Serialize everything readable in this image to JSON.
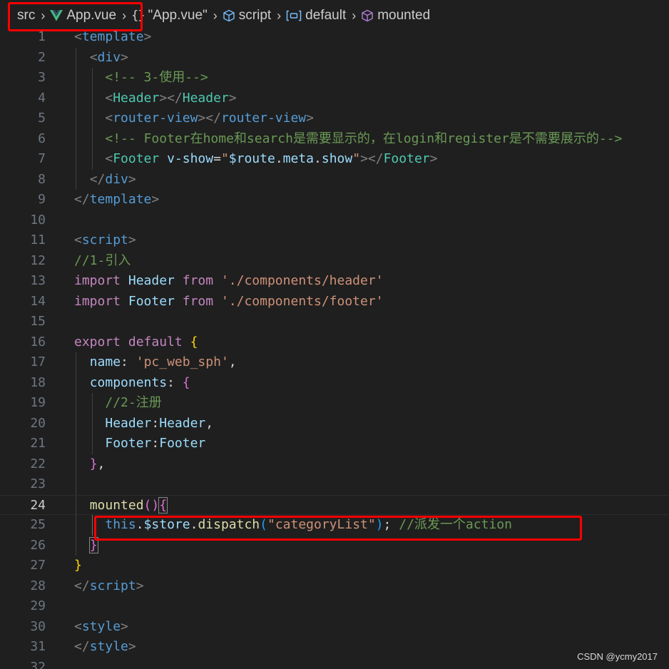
{
  "breadcrumb": {
    "items": [
      {
        "label": "src",
        "icon": "folder"
      },
      {
        "label": "App.vue",
        "icon": "vue-logo-icon"
      },
      {
        "label": "\"App.vue\"",
        "icon": "curly-braces-icon"
      },
      {
        "label": "script",
        "icon": "cube-icon"
      },
      {
        "label": "default",
        "icon": "variable-icon"
      },
      {
        "label": "mounted",
        "icon": "method-cube-icon"
      }
    ]
  },
  "editor": {
    "active_line": 24,
    "lines": [
      {
        "n": "1",
        "tokens": [
          {
            "t": "<",
            "c": "tag-b"
          },
          {
            "t": "template",
            "c": "tag"
          },
          {
            "t": ">",
            "c": "tag-b"
          }
        ]
      },
      {
        "n": "2",
        "tokens": [
          {
            "t": "  "
          },
          {
            "t": "<",
            "c": "tag-b"
          },
          {
            "t": "div",
            "c": "tag"
          },
          {
            "t": ">",
            "c": "tag-b"
          }
        ]
      },
      {
        "n": "3",
        "tokens": [
          {
            "t": "    "
          },
          {
            "t": "<!-- 3-使用-->",
            "c": "cm"
          }
        ]
      },
      {
        "n": "4",
        "tokens": [
          {
            "t": "    "
          },
          {
            "t": "<",
            "c": "tag-b"
          },
          {
            "t": "Header",
            "c": "tag-c"
          },
          {
            "t": "></",
            "c": "tag-b"
          },
          {
            "t": "Header",
            "c": "tag-c"
          },
          {
            "t": ">",
            "c": "tag-b"
          }
        ]
      },
      {
        "n": "5",
        "tokens": [
          {
            "t": "    "
          },
          {
            "t": "<",
            "c": "tag-b"
          },
          {
            "t": "router-view",
            "c": "tag"
          },
          {
            "t": "></",
            "c": "tag-b"
          },
          {
            "t": "router-view",
            "c": "tag"
          },
          {
            "t": ">",
            "c": "tag-b"
          }
        ]
      },
      {
        "n": "6",
        "tokens": [
          {
            "t": "    "
          },
          {
            "t": "<!-- Footer在home和search是需要显示的，在login和register是不需要展示的-->",
            "c": "cm"
          }
        ]
      },
      {
        "n": "7",
        "tokens": [
          {
            "t": "    "
          },
          {
            "t": "<",
            "c": "tag-b"
          },
          {
            "t": "Footer",
            "c": "tag-c"
          },
          {
            "t": " "
          },
          {
            "t": "v-show",
            "c": "id"
          },
          {
            "t": "=",
            "c": "pl"
          },
          {
            "t": "\"",
            "c": "str"
          },
          {
            "t": "$route",
            "c": "id"
          },
          {
            "t": ".",
            "c": "pl"
          },
          {
            "t": "meta",
            "c": "id"
          },
          {
            "t": ".",
            "c": "pl"
          },
          {
            "t": "show",
            "c": "id"
          },
          {
            "t": "\"",
            "c": "str"
          },
          {
            "t": "></",
            "c": "tag-b"
          },
          {
            "t": "Footer",
            "c": "tag-c"
          },
          {
            "t": ">",
            "c": "tag-b"
          }
        ]
      },
      {
        "n": "8",
        "tokens": [
          {
            "t": "  "
          },
          {
            "t": "</",
            "c": "tag-b"
          },
          {
            "t": "div",
            "c": "tag"
          },
          {
            "t": ">",
            "c": "tag-b"
          }
        ]
      },
      {
        "n": "9",
        "tokens": [
          {
            "t": "</",
            "c": "tag-b"
          },
          {
            "t": "template",
            "c": "tag"
          },
          {
            "t": ">",
            "c": "tag-b"
          }
        ]
      },
      {
        "n": "10",
        "tokens": []
      },
      {
        "n": "11",
        "tokens": [
          {
            "t": "<",
            "c": "tag-b"
          },
          {
            "t": "script",
            "c": "tag"
          },
          {
            "t": ">",
            "c": "tag-b"
          }
        ]
      },
      {
        "n": "12",
        "tokens": [
          {
            "t": "//1-引入",
            "c": "cm"
          }
        ]
      },
      {
        "n": "13",
        "tokens": [
          {
            "t": "import",
            "c": "kw"
          },
          {
            "t": " "
          },
          {
            "t": "Header",
            "c": "id"
          },
          {
            "t": " "
          },
          {
            "t": "from",
            "c": "kw"
          },
          {
            "t": " "
          },
          {
            "t": "'./components/header'",
            "c": "str"
          }
        ]
      },
      {
        "n": "14",
        "tokens": [
          {
            "t": "import",
            "c": "kw"
          },
          {
            "t": " "
          },
          {
            "t": "Footer",
            "c": "id"
          },
          {
            "t": " "
          },
          {
            "t": "from",
            "c": "kw"
          },
          {
            "t": " "
          },
          {
            "t": "'./components/footer'",
            "c": "str"
          }
        ]
      },
      {
        "n": "15",
        "tokens": []
      },
      {
        "n": "16",
        "tokens": [
          {
            "t": "export",
            "c": "kw"
          },
          {
            "t": " "
          },
          {
            "t": "default",
            "c": "kw"
          },
          {
            "t": " "
          },
          {
            "t": "{",
            "c": "br1"
          }
        ]
      },
      {
        "n": "17",
        "tokens": [
          {
            "t": "  "
          },
          {
            "t": "name",
            "c": "prop"
          },
          {
            "t": ": ",
            "c": "pl"
          },
          {
            "t": "'pc_web_sph'",
            "c": "str"
          },
          {
            "t": ",",
            "c": "pl"
          }
        ]
      },
      {
        "n": "18",
        "tokens": [
          {
            "t": "  "
          },
          {
            "t": "components",
            "c": "prop"
          },
          {
            "t": ": ",
            "c": "pl"
          },
          {
            "t": "{",
            "c": "br2"
          }
        ]
      },
      {
        "n": "19",
        "tokens": [
          {
            "t": "    "
          },
          {
            "t": "//2-注册",
            "c": "cm"
          }
        ]
      },
      {
        "n": "20",
        "tokens": [
          {
            "t": "    "
          },
          {
            "t": "Header",
            "c": "prop"
          },
          {
            "t": ":",
            "c": "pl"
          },
          {
            "t": "Header",
            "c": "id"
          },
          {
            "t": ",",
            "c": "pl"
          }
        ]
      },
      {
        "n": "21",
        "tokens": [
          {
            "t": "    "
          },
          {
            "t": "Footer",
            "c": "prop"
          },
          {
            "t": ":",
            "c": "pl"
          },
          {
            "t": "Footer",
            "c": "id"
          }
        ]
      },
      {
        "n": "22",
        "tokens": [
          {
            "t": "  "
          },
          {
            "t": "}",
            "c": "br2"
          },
          {
            "t": ",",
            "c": "pl"
          }
        ]
      },
      {
        "n": "23",
        "tokens": []
      },
      {
        "n": "24",
        "tokens": [
          {
            "t": "  "
          },
          {
            "t": "mounted",
            "c": "fn"
          },
          {
            "t": "()",
            "c": "br2"
          },
          {
            "t": "{",
            "c": "br2",
            "m": true
          }
        ]
      },
      {
        "n": "25",
        "tokens": [
          {
            "t": "    "
          },
          {
            "t": "this",
            "c": "tag"
          },
          {
            "t": ".",
            "c": "pl"
          },
          {
            "t": "$store",
            "c": "id"
          },
          {
            "t": ".",
            "c": "pl"
          },
          {
            "t": "dispatch",
            "c": "fn"
          },
          {
            "t": "(",
            "c": "br3"
          },
          {
            "t": "\"categoryList\"",
            "c": "str"
          },
          {
            "t": ")",
            "c": "br3"
          },
          {
            "t": "; ",
            "c": "pl"
          },
          {
            "t": "//派发一个action",
            "c": "cm"
          }
        ]
      },
      {
        "n": "26",
        "tokens": [
          {
            "t": "  "
          },
          {
            "t": "}",
            "c": "br2",
            "m": true
          }
        ]
      },
      {
        "n": "27",
        "tokens": [
          {
            "t": "}",
            "c": "br1"
          }
        ]
      },
      {
        "n": "28",
        "tokens": [
          {
            "t": "</",
            "c": "tag-b"
          },
          {
            "t": "script",
            "c": "tag"
          },
          {
            "t": ">",
            "c": "tag-b"
          }
        ]
      },
      {
        "n": "29",
        "tokens": []
      },
      {
        "n": "30",
        "tokens": [
          {
            "t": "<",
            "c": "tag-b"
          },
          {
            "t": "style",
            "c": "tag"
          },
          {
            "t": ">",
            "c": "tag-b"
          }
        ]
      },
      {
        "n": "31",
        "tokens": [
          {
            "t": "</",
            "c": "tag-b"
          },
          {
            "t": "style",
            "c": "tag"
          },
          {
            "t": ">",
            "c": "tag-b"
          }
        ]
      },
      {
        "n": "32",
        "tokens": []
      }
    ]
  },
  "watermark": "CSDN @ycmy2017",
  "colors": {
    "background": "#1f1f1f",
    "highlight_box": "#ff0000",
    "vue_green": "#42b883",
    "symbol_purple": "#b180d7",
    "variable_blue": "#75beff"
  }
}
